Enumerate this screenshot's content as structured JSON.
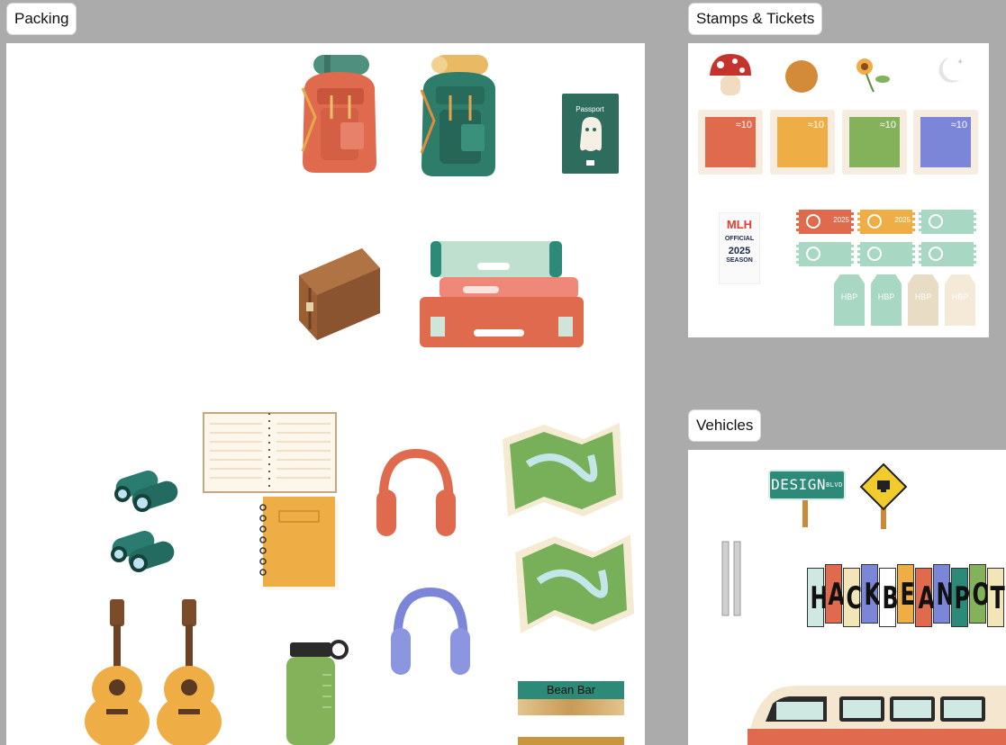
{
  "frames": {
    "packing": {
      "title": "Packing"
    },
    "stamps": {
      "title": "Stamps & Tickets"
    },
    "vehicles": {
      "title": "Vehicles"
    }
  },
  "stickers": {
    "passport": {
      "label": "Passport",
      "icon": "passport-icon"
    },
    "bean_bar": {
      "label": "Bean Bar",
      "icon": "snack-bar-icon"
    },
    "stamps": [
      {
        "value": "≈10",
        "color": "#e06a4e"
      },
      {
        "value": "≈10",
        "color": "#efae45"
      },
      {
        "value": "≈10",
        "color": "#84b25b"
      },
      {
        "value": "≈10",
        "color": "#7b86d9"
      }
    ],
    "mlh": {
      "logo": "MLH",
      "line1": "OFFICIAL",
      "line2": "2025",
      "line3": "SEASON"
    },
    "tickets": {
      "year": "2025"
    },
    "tags": {
      "text": "HBP"
    },
    "street_sign": {
      "name": "DESIGN",
      "suffix": "BLVD"
    },
    "license_plates": {
      "letters": [
        "H",
        "A",
        "C",
        "K",
        "B",
        "E",
        "A",
        "N",
        "P",
        "O",
        "T"
      ]
    }
  },
  "colors": {
    "canvas": "#ababab",
    "coral": "#e06a4e",
    "teal": "#2e7d6b",
    "mustard": "#efae45",
    "green": "#84b25b",
    "periwinkle": "#7b86d9"
  }
}
